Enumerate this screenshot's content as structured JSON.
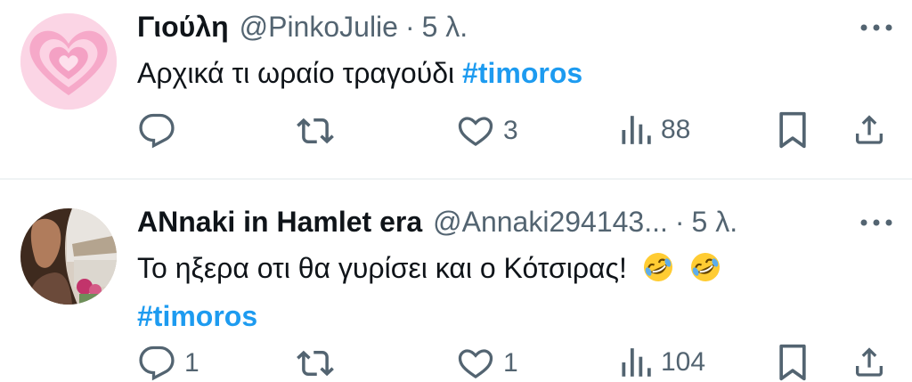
{
  "tweets": [
    {
      "name": "Γιούλη",
      "handle": "@PinkoJulie",
      "separator": "·",
      "time": "5 λ.",
      "text": "Αρχικά τι ωραίο τραγούδι",
      "hashtag": "#timoros",
      "more_icon": "more-dots-icon",
      "actions": {
        "reply": "",
        "retweet": "",
        "like": "3",
        "views": "88"
      }
    },
    {
      "name": "ANnaki in Hamlet era",
      "handle": "@Annaki294143...",
      "separator": "·",
      "time": "5 λ.",
      "text": "Το ηξερα οτι θα γυρίσει και ο Κότσιρας!",
      "hashtag": "#timoros",
      "more_icon": "more-dots-icon",
      "actions": {
        "reply": "1",
        "retweet": "",
        "like": "1",
        "views": "104"
      }
    }
  ],
  "icons": [
    "reply-icon",
    "retweet-icon",
    "like-icon",
    "views-icon",
    "bookmark-icon",
    "share-icon",
    "rofl-emoji-icon"
  ],
  "colors": {
    "hashtag": "#1d9bf0",
    "secondary_text": "#536471",
    "divider": "#eff3f4"
  }
}
